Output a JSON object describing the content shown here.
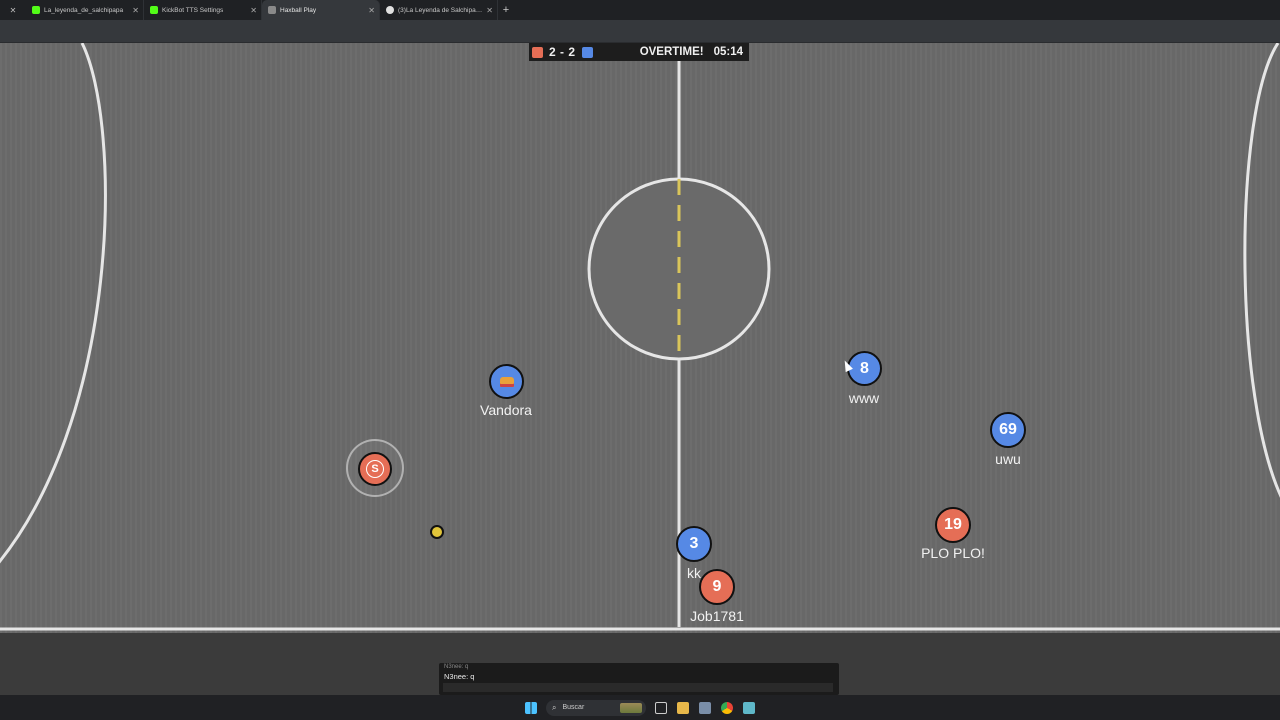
{
  "browser": {
    "tabs": [
      {
        "title": "La_leyenda_de_salchipapa",
        "favicon_color": "#53fc18",
        "active": false
      },
      {
        "title": "KickBot TTS Settings",
        "favicon_color": "#53fc18",
        "active": false
      },
      {
        "title": "Haxball Play",
        "favicon_color": "#8a8a8a",
        "active": true
      },
      {
        "title": "(3)La Leyenda de Salchipapa (£",
        "favicon_color": "#e0e0e0",
        "active": false
      }
    ],
    "new_tab_icon": "plus-icon",
    "close_icon": "close-icon"
  },
  "scoreboard": {
    "red_score": "2",
    "separator": "-",
    "blue_score": "2",
    "score_text": "2 - 2",
    "status": "OVERTIME!",
    "time": "05:14",
    "colors": {
      "red": "#e56e56",
      "blue": "#5689e5"
    }
  },
  "players": [
    {
      "id": "vandora",
      "team": "blue",
      "avatar": "",
      "avatar_icon": "crown-icon",
      "name": "Vandora"
    },
    {
      "id": "s",
      "team": "red",
      "avatar": "S",
      "name": "",
      "controlled": true
    },
    {
      "id": "www",
      "team": "blue",
      "avatar": "8",
      "name": "www"
    },
    {
      "id": "uwu",
      "team": "blue",
      "avatar": "69",
      "name": "uwu"
    },
    {
      "id": "plo",
      "team": "red",
      "avatar": "19",
      "name": "PLO PLO!"
    },
    {
      "id": "kk",
      "team": "blue",
      "avatar": "3",
      "name": "kk"
    },
    {
      "id": "job",
      "team": "red",
      "avatar": "9",
      "name": "Job1781"
    }
  ],
  "ball": {
    "color": "#e1c53a"
  },
  "chat": {
    "previous_line": "N3nee: q",
    "last_line": "N3nee: q",
    "input_placeholder": ""
  },
  "taskbar": {
    "search_label": "Buscar",
    "icons": [
      "windows-icon",
      "search-icon",
      "landscape-widget-icon",
      "task-view-icon",
      "file-explorer-icon",
      "snipping-tool-icon",
      "chrome-icon",
      "notepad-icon"
    ]
  }
}
